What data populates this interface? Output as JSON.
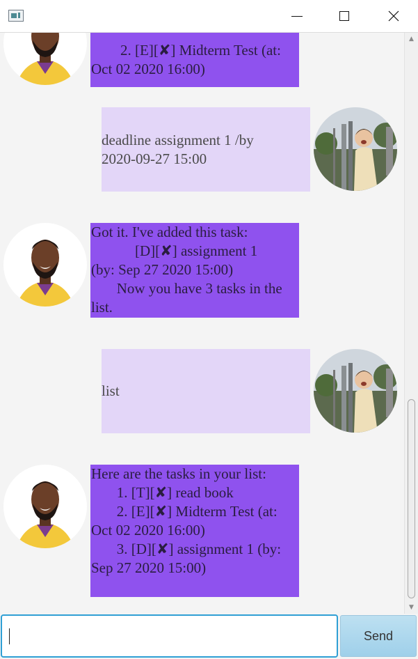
{
  "window": {
    "title": "",
    "controls": {
      "minimize": "minimize-icon",
      "maximize": "maximize-icon",
      "close": "close-icon"
    }
  },
  "messages": [
    {
      "from": "bot",
      "text": "        2. [E][✘] Midterm Test (at:\nOct 02 2020 16:00)"
    },
    {
      "from": "user",
      "text": "deadline assignment 1 /by\n2020-09-27 15:00"
    },
    {
      "from": "bot",
      "text": "Got it. I've added this task:\n            [D][✘] assignment 1\n(by: Sep 27 2020 15:00)\n       Now you have 3 tasks in the\nlist."
    },
    {
      "from": "user",
      "text": "list"
    },
    {
      "from": "bot",
      "text": "Here are the tasks in your list:\n       1. [T][✘] read book\n       2. [E][✘] Midterm Test (at:\nOct 02 2020 16:00)\n       3. [D][✘] assignment 1 (by:\nSep 27 2020 15:00)"
    }
  ],
  "input": {
    "value": "",
    "placeholder": ""
  },
  "send_button": {
    "label": "Send"
  },
  "colors": {
    "bot_bubble": "#8f52ee",
    "user_bubble": "#e3d6f8",
    "input_focus": "#2f9fd4",
    "send_bg": "#a9d6ee"
  }
}
